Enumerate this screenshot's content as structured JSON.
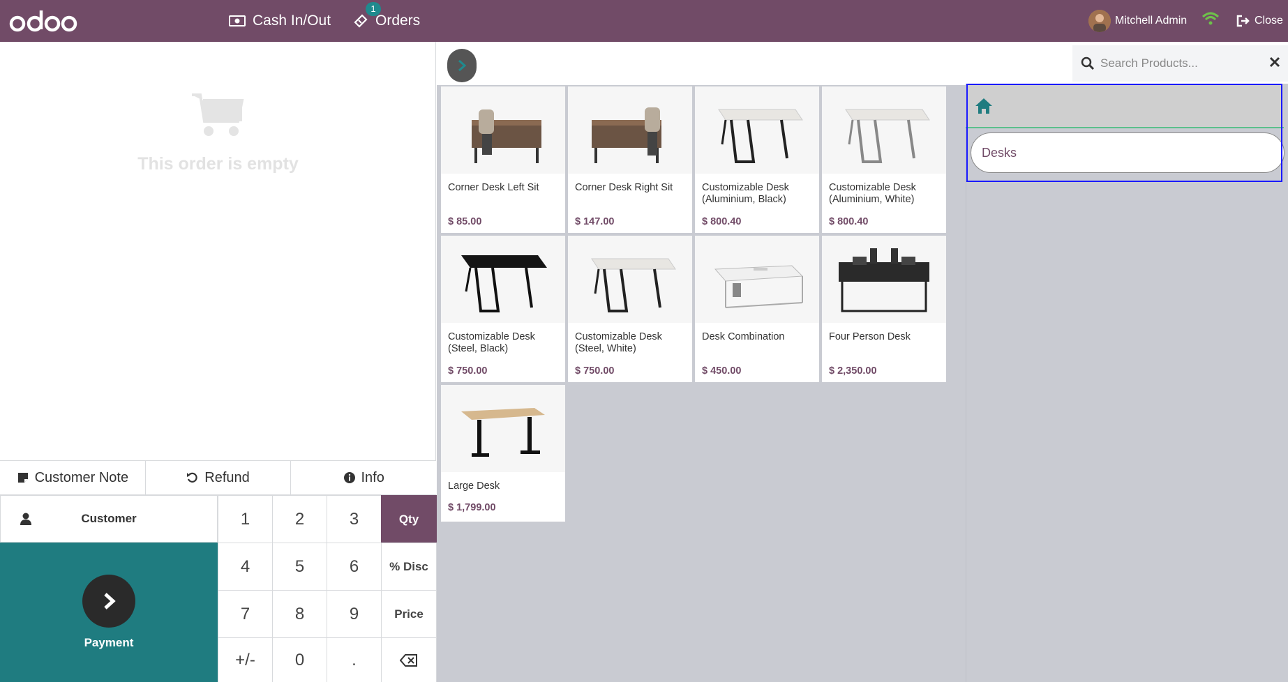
{
  "topbar": {
    "logo_text": "odoo",
    "cash_label": "Cash In/Out",
    "orders_label": "Orders",
    "orders_badge": "1",
    "user_name": "Mitchell Admin",
    "close_label": "Close",
    "brand_color": "#714b67"
  },
  "order": {
    "empty_message": "This order is empty"
  },
  "controls": {
    "customer_note": "Customer Note",
    "refund": "Refund",
    "info": "Info",
    "customer": "Customer",
    "payment": "Payment"
  },
  "numpad": {
    "keys": [
      "1",
      "2",
      "3",
      "Qty",
      "4",
      "5",
      "6",
      "% Disc",
      "7",
      "8",
      "9",
      "Price",
      "+/-",
      "0",
      "."
    ],
    "backspace_icon": "backspace-icon",
    "active_mode": "Qty"
  },
  "search": {
    "placeholder": "Search Products..."
  },
  "products": [
    {
      "name": "Corner Desk Left Sit",
      "price": "$ 85.00"
    },
    {
      "name": "Corner Desk Right Sit",
      "price": "$ 147.00"
    },
    {
      "name": "Customizable Desk (Aluminium, Black)",
      "price": "$ 800.40"
    },
    {
      "name": "Customizable Desk (Aluminium, White)",
      "price": "$ 800.40"
    },
    {
      "name": "Customizable Desk (Steel, Black)",
      "price": "$ 750.00"
    },
    {
      "name": "Customizable Desk (Steel, White)",
      "price": "$ 750.00"
    },
    {
      "name": "Desk Combination",
      "price": "$ 450.00"
    },
    {
      "name": "Four Person Desk",
      "price": "$ 2,350.00"
    },
    {
      "name": "Large Desk",
      "price": "$ 1,799.00"
    }
  ],
  "categories": {
    "home_icon": "home-icon",
    "items": [
      "Desks"
    ]
  }
}
